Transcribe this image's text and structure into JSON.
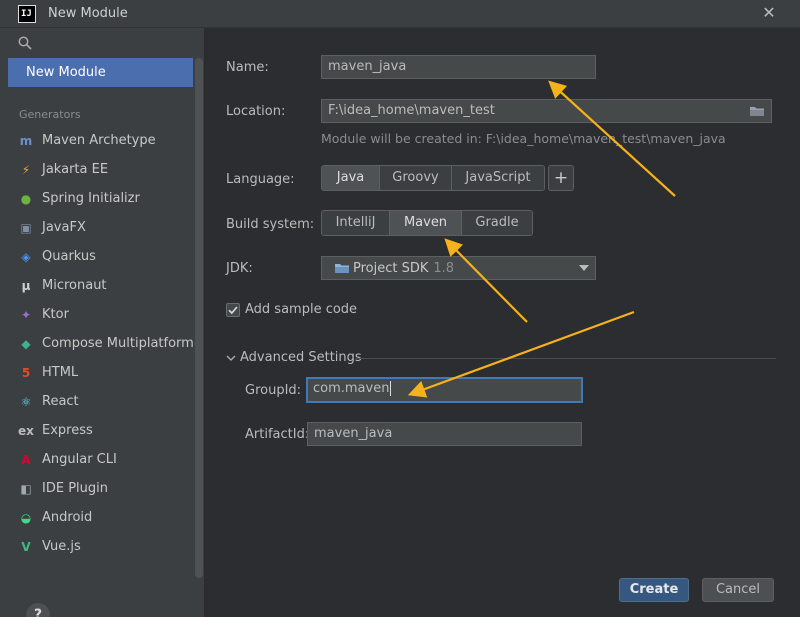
{
  "window": {
    "title": "New Module",
    "app_icon_text": "IJ"
  },
  "sidebar": {
    "selected": "New Module",
    "section_label": "Generators",
    "generators": [
      {
        "label": "Maven Archetype",
        "icon": "maven-icon",
        "glyph": "m",
        "color": "#6d8fd0"
      },
      {
        "label": "Jakarta EE",
        "icon": "jakarta-icon",
        "glyph": "⚡",
        "color": "#e8a33d"
      },
      {
        "label": "Spring Initializr",
        "icon": "spring-icon",
        "glyph": "●",
        "color": "#6db33f"
      },
      {
        "label": "JavaFX",
        "icon": "javafx-icon",
        "glyph": "▣",
        "color": "#7f8fa6"
      },
      {
        "label": "Quarkus",
        "icon": "quarkus-icon",
        "glyph": "◈",
        "color": "#4695eb"
      },
      {
        "label": "Micronaut",
        "icon": "micronaut-icon",
        "glyph": "μ",
        "color": "#cfcfcf"
      },
      {
        "label": "Ktor",
        "icon": "ktor-icon",
        "glyph": "✦",
        "color": "#9d6bd8"
      },
      {
        "label": "Compose Multiplatform",
        "icon": "compose-icon",
        "glyph": "◆",
        "color": "#3fb28c"
      },
      {
        "label": "HTML",
        "icon": "html-icon",
        "glyph": "5",
        "color": "#e44d26"
      },
      {
        "label": "React",
        "icon": "react-icon",
        "glyph": "⚛",
        "color": "#61dafb"
      },
      {
        "label": "Express",
        "icon": "express-icon",
        "glyph": "ex",
        "color": "#bbbbbb"
      },
      {
        "label": "Angular CLI",
        "icon": "angular-icon",
        "glyph": "A",
        "color": "#dd0031"
      },
      {
        "label": "IDE Plugin",
        "icon": "plugin-icon",
        "glyph": "◧",
        "color": "#a0a8b4"
      },
      {
        "label": "Android",
        "icon": "android-icon",
        "glyph": "◒",
        "color": "#3ddc84"
      },
      {
        "label": "Vue.js",
        "icon": "vue-icon",
        "glyph": "V",
        "color": "#42b883"
      }
    ],
    "help_label": "?"
  },
  "form": {
    "name_label": "Name:",
    "name_value": "maven_java",
    "location_label": "Location:",
    "location_value": "F:\\idea_home\\maven_test",
    "location_hint": "Module will be created in: F:\\idea_home\\maven_test\\maven_java",
    "language_label": "Language:",
    "languages": [
      "Java",
      "Groovy",
      "JavaScript"
    ],
    "language_selected": "Java",
    "add_language_label": "+",
    "build_label": "Build system:",
    "build_systems": [
      "IntelliJ",
      "Maven",
      "Gradle"
    ],
    "build_selected": "Maven",
    "jdk_label": "JDK:",
    "jdk_name": "Project SDK",
    "jdk_version": "1.8",
    "sample_code_label": "Add sample code",
    "sample_code_checked": true,
    "advanced_label": "Advanced Settings",
    "groupid_label": "GroupId:",
    "groupid_value": "com.maven",
    "artifactid_label": "ArtifactId:",
    "artifactid_value": "maven_java"
  },
  "buttons": {
    "create": "Create",
    "cancel": "Cancel"
  },
  "colors": {
    "accent": "#4b6eaf",
    "annotation_arrow": "#f5b21a",
    "focus_border": "#3d79bd"
  }
}
